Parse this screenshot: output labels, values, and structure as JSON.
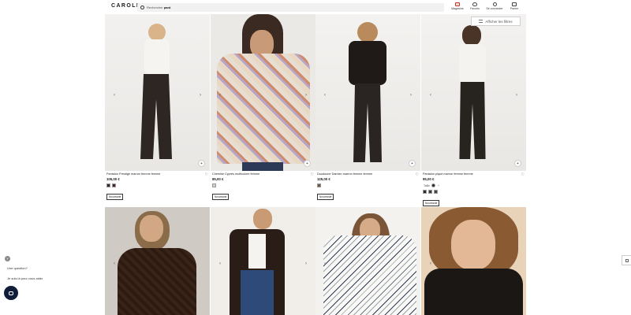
{
  "header": {
    "logo": "CAROLL",
    "search_placeholder": "Rechercher",
    "search_value": "pant",
    "nav": [
      {
        "label": "Magasins",
        "icon": "store-icon"
      },
      {
        "label": "Favoris",
        "icon": "heart-icon"
      },
      {
        "label": "Se connecter",
        "icon": "user-icon"
      },
      {
        "label": "Panier",
        "icon": "bag-icon"
      }
    ]
  },
  "filters_label": "Afficher les filtres",
  "products": [
    {
      "name": "Pantalon Prestige marron femme femme",
      "price": "105,00 €",
      "swatches": [
        "#2e2a28",
        "#4a2526"
      ],
      "badge": "Nouveauté"
    },
    {
      "name": "Chemise Cyprès multicolore femme",
      "price": "85,00 €",
      "swatches": [
        "#d9cfc2"
      ],
      "badge": "Nouveauté"
    },
    {
      "name": "Doudoune Damien marron femme femme",
      "price": "125,00 €",
      "swatches": [
        "#6d5a3c"
      ],
      "badge": "Nouveauté"
    },
    {
      "name": "Pantalon piqué marron femme femme",
      "price": "95,00 €",
      "swatches": [
        "#2e2a28",
        "#3c3c3c"
      ],
      "swatch_label": "Taille",
      "extra_swatches": [
        "#2a2a2a",
        "#3a3a3a",
        "#454545"
      ],
      "badge": "Nouveauté"
    },
    {
      "name": "",
      "price": "",
      "swatches": [],
      "badge": ""
    },
    {
      "name": "",
      "price": "",
      "swatches": [],
      "badge": ""
    },
    {
      "name": "",
      "price": "",
      "swatches": [],
      "badge": ""
    },
    {
      "name": "",
      "price": "",
      "swatches": [],
      "badge": ""
    }
  ],
  "chat": {
    "question": "Une question?",
    "help": "Je suis là pour vous aider"
  },
  "colors": {
    "store_accent": "#c0392b",
    "chat_button": "#0f1d3a"
  }
}
